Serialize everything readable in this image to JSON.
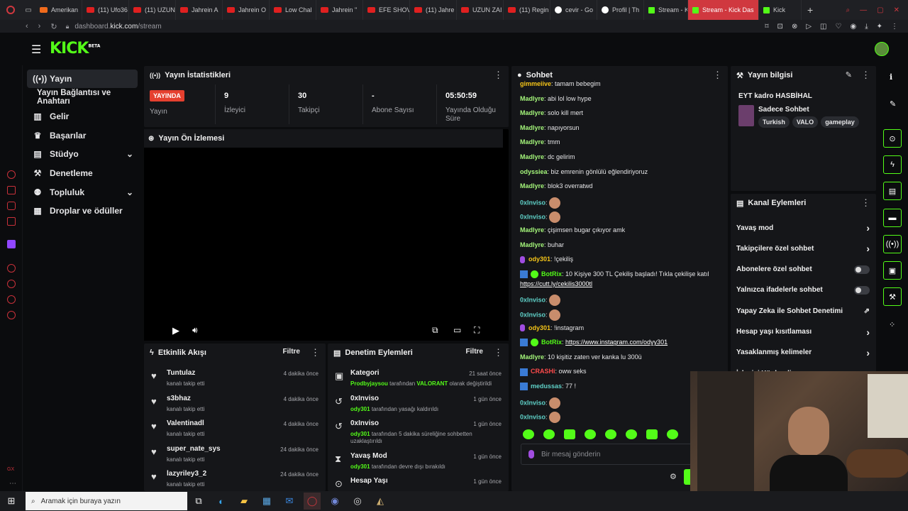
{
  "browser": {
    "tabs": [
      "Amerikan",
      "(11) Ufo36",
      "(11) UZUN",
      "Jahrein A",
      "Jahrein O",
      "Low Chal",
      "Jahrein \"",
      "EFE SHOV",
      "(11) Jahre",
      "UZUN ZAI",
      "(11) Regin",
      "cevir - Go",
      "Profil | Th",
      "Stream - K",
      "Stream - Kick Das",
      "Kick"
    ],
    "active_tab": 14,
    "url_prefix": "dashboard.",
    "url_host": "kick.com",
    "url_path": "/stream"
  },
  "app": {
    "logo": "KICK",
    "logo_sup": "BETA"
  },
  "sidebar": {
    "items": [
      {
        "label": "Yayın",
        "icon": "broadcast-icon"
      },
      {
        "label": "Yayın Bağlantısı ve Anahtarı"
      },
      {
        "label": "Gelir",
        "icon": "chart-icon"
      },
      {
        "label": "Başarılar",
        "icon": "trophy-icon"
      },
      {
        "label": "Stüdyo",
        "icon": "studio-icon"
      },
      {
        "label": "Denetleme",
        "icon": "wrench-icon"
      },
      {
        "label": "Topluluk",
        "icon": "community-icon"
      },
      {
        "label": "Droplar ve ödüller",
        "icon": "gift-icon"
      }
    ]
  },
  "stats": {
    "title": "Yayın İstatistikleri",
    "live_badge": "YAYINDA",
    "items": [
      {
        "value": "",
        "label": "Yayın"
      },
      {
        "value": "9",
        "label": "İzleyici"
      },
      {
        "value": "30",
        "label": "Takipçi"
      },
      {
        "value": "-",
        "label": "Abone Sayısı"
      },
      {
        "value": "05:50:59",
        "label": "Yayında Olduğu Süre"
      }
    ]
  },
  "preview": {
    "title": "Yayın Ön İzlemesi"
  },
  "activity": {
    "title": "Etkinlik Akışı",
    "filter": "Filtre",
    "items": [
      {
        "name": "Tuntulaz",
        "sub": "kanalı takip etti",
        "time": "4 dakika önce"
      },
      {
        "name": "s3bhaz",
        "sub": "kanalı takip etti",
        "time": "4 dakika önce"
      },
      {
        "name": "Valentinadl",
        "sub": "kanalı takip etti",
        "time": "4 dakika önce"
      },
      {
        "name": "super_nate_sys",
        "sub": "kanalı takip etti",
        "time": "24 dakika önce"
      },
      {
        "name": "lazyriley3_2",
        "sub": "kanalı takip etti",
        "time": "24 dakika önce"
      }
    ]
  },
  "moderation": {
    "title": "Denetim Eylemleri",
    "filter": "Filtre",
    "items": [
      {
        "name": "Kategori",
        "actor": "Prodbyjaysou",
        "text": "tarafından",
        "extra": "VALORANT",
        "text2": "olarak değiştirildi",
        "time": "21 saat önce"
      },
      {
        "name": "0xInviso",
        "actor": "ody301",
        "text": "tarafından yasağı kaldırıldı",
        "extra": "",
        "text2": "",
        "time": "1 gün önce"
      },
      {
        "name": "0xInviso",
        "actor": "ody301",
        "text": "tarafından 5 dakika süreliğine sohbetten uzaklaştırıldı",
        "extra": "",
        "text2": "",
        "time": "1 gün önce"
      },
      {
        "name": "Yavaş Mod",
        "actor": "ody301",
        "text": "tarafından devre dışı bırakıldı",
        "extra": "",
        "text2": "",
        "time": "1 gün önce"
      },
      {
        "name": "Hesap Yaşı",
        "actor": "",
        "text": "",
        "extra": "",
        "text2": "",
        "time": "1 gün önce"
      }
    ]
  },
  "chat": {
    "title": "Sohbet",
    "placeholder": "Bir mesaj gönderin",
    "lines": [
      {
        "user": "gimmeiive",
        "msg": "tamam bebegim",
        "color": "#f5c518"
      },
      {
        "user": "Madlyre",
        "msg": "abi lol low hype",
        "color": "#a4f57a"
      },
      {
        "user": "Madlyre",
        "msg": "solo kill mert",
        "color": "#a4f57a"
      },
      {
        "user": "Madlyre",
        "msg": "napıyorsun",
        "color": "#a4f57a"
      },
      {
        "user": "Madlyre",
        "msg": "tmm",
        "color": "#a4f57a"
      },
      {
        "user": "Madlyre",
        "msg": "dc gelirim",
        "color": "#a4f57a"
      },
      {
        "user": "odyssiea",
        "msg": "biz emrenin gönlülü eğlendiriyoruz",
        "color": "#a4f57a"
      },
      {
        "user": "Madlyre",
        "msg": "blok3 overratwd",
        "color": "#a4f57a"
      },
      {
        "user": "0xInviso",
        "msg": "",
        "color": "#5fd1c8"
      },
      {
        "user": "0xInviso",
        "msg": "",
        "color": "#5fd1c8"
      },
      {
        "user": "Madlyre",
        "msg": "çişimsen bugar çıkıyor amk",
        "color": "#a4f57a"
      },
      {
        "user": "Madlyre",
        "msg": "buhar",
        "color": "#a4f57a"
      },
      {
        "user": "ody301",
        "msg": "!çekiliş",
        "color": "#f5c518"
      },
      {
        "user": "BotRix",
        "msg": "10 Kişiye 300 TL Çekiliş başladı! Tıkla çekilişe katıl",
        "color": "#53fc18"
      },
      {
        "user": "",
        "msg": "https://cutt.ly/cekilis3000tl",
        "color": "#ffffff"
      },
      {
        "user": "0xInviso",
        "msg": "",
        "color": "#5fd1c8"
      },
      {
        "user": "0xInviso",
        "msg": "",
        "color": "#5fd1c8"
      },
      {
        "user": "ody301",
        "msg": "!instagram",
        "color": "#f5c518"
      },
      {
        "user": "BotRix",
        "msg": "https://www.instagram.com/odyy301",
        "color": "#53fc18"
      },
      {
        "user": "Madlyre",
        "msg": "10 kişitiz zaten ver kanka lu 300ü",
        "color": "#a4f57a"
      },
      {
        "user": "CRASHi",
        "msg": "oww seks",
        "color": "#ff4b4b"
      },
      {
        "user": "medussas",
        "msg": "77 !",
        "color": "#5fd1c8"
      },
      {
        "user": "0xInviso",
        "msg": "",
        "color": "#5fd1c8"
      },
      {
        "user": "0xInviso",
        "msg": "",
        "color": "#5fd1c8"
      }
    ]
  },
  "stream_info": {
    "title": "Yayın bilgisi",
    "stream_title": "EYT kadro HASBİHAL",
    "category": "Sadece Sohbet",
    "tags": [
      "Turkish",
      "VALO",
      "gameplay"
    ]
  },
  "channel_actions": {
    "title": "Kanal Eylemleri",
    "items": [
      {
        "label": "Yavaş mod",
        "control": "chevron"
      },
      {
        "label": "Takipçilere özel sohbet",
        "control": "chevron"
      },
      {
        "label": "Abonelere özel sohbet",
        "control": "toggle"
      },
      {
        "label": "Yalnızca ifadelerle sohbet",
        "control": "toggle"
      },
      {
        "label": "Yapay Zeka ile Sohbet Denetimi",
        "control": "external"
      },
      {
        "label": "Hesap yaşı kısıtlaması",
        "control": "chevron"
      },
      {
        "label": "Yasaklanmış kelimeler",
        "control": "chevron"
      },
      {
        "label": "İzleyici Yönlendir",
        "control": "none"
      }
    ]
  },
  "taskbar": {
    "search_placeholder": "Aramak için buraya yazın"
  },
  "colors": {
    "accent": "#53fc18",
    "live": "#e5402f",
    "panel": "#151619"
  }
}
